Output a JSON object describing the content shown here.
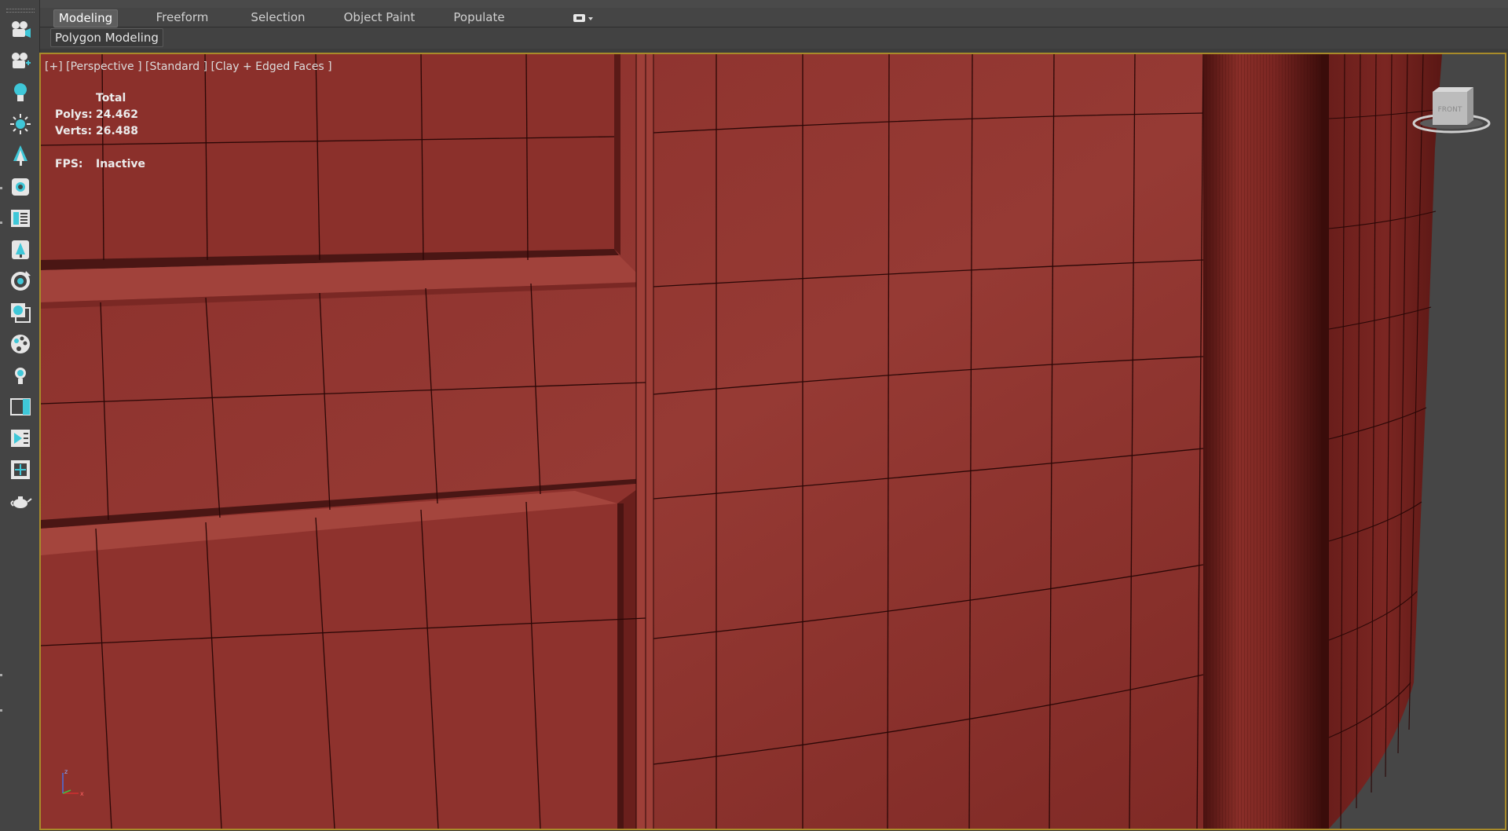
{
  "ribbon": {
    "tabs": [
      {
        "label": "Modeling",
        "active": true
      },
      {
        "label": "Freeform",
        "active": false
      },
      {
        "label": "Selection",
        "active": false
      },
      {
        "label": "Object Paint",
        "active": false
      },
      {
        "label": "Populate",
        "active": false
      }
    ],
    "sub_panel_label": "Polygon Modeling"
  },
  "toolbar": {
    "icons": [
      "camera-icon",
      "camera-add-icon",
      "light-bulb-icon",
      "sun-icon",
      "tree-icon",
      "paint-brush-icon",
      "library-icon",
      "tree-stamp-icon",
      "rotate-icon",
      "layers-icon",
      "palette-icon",
      "bulb-small-icon",
      "viewport-icon",
      "render-icon",
      "grid-select-icon",
      "teapot-icon"
    ]
  },
  "viewport": {
    "label": "[+] [Perspective ] [Standard ] [Clay + Edged Faces ]",
    "stats_header": "Total",
    "polys_label": "Polys:",
    "polys_value": "24.462",
    "verts_label": "Verts:",
    "verts_value": "26.488",
    "fps_label": "FPS:",
    "fps_value": "Inactive",
    "viewcube_face": "FRONT",
    "border_color": "#a88b2a",
    "clay_color": "#8c2f2b"
  }
}
